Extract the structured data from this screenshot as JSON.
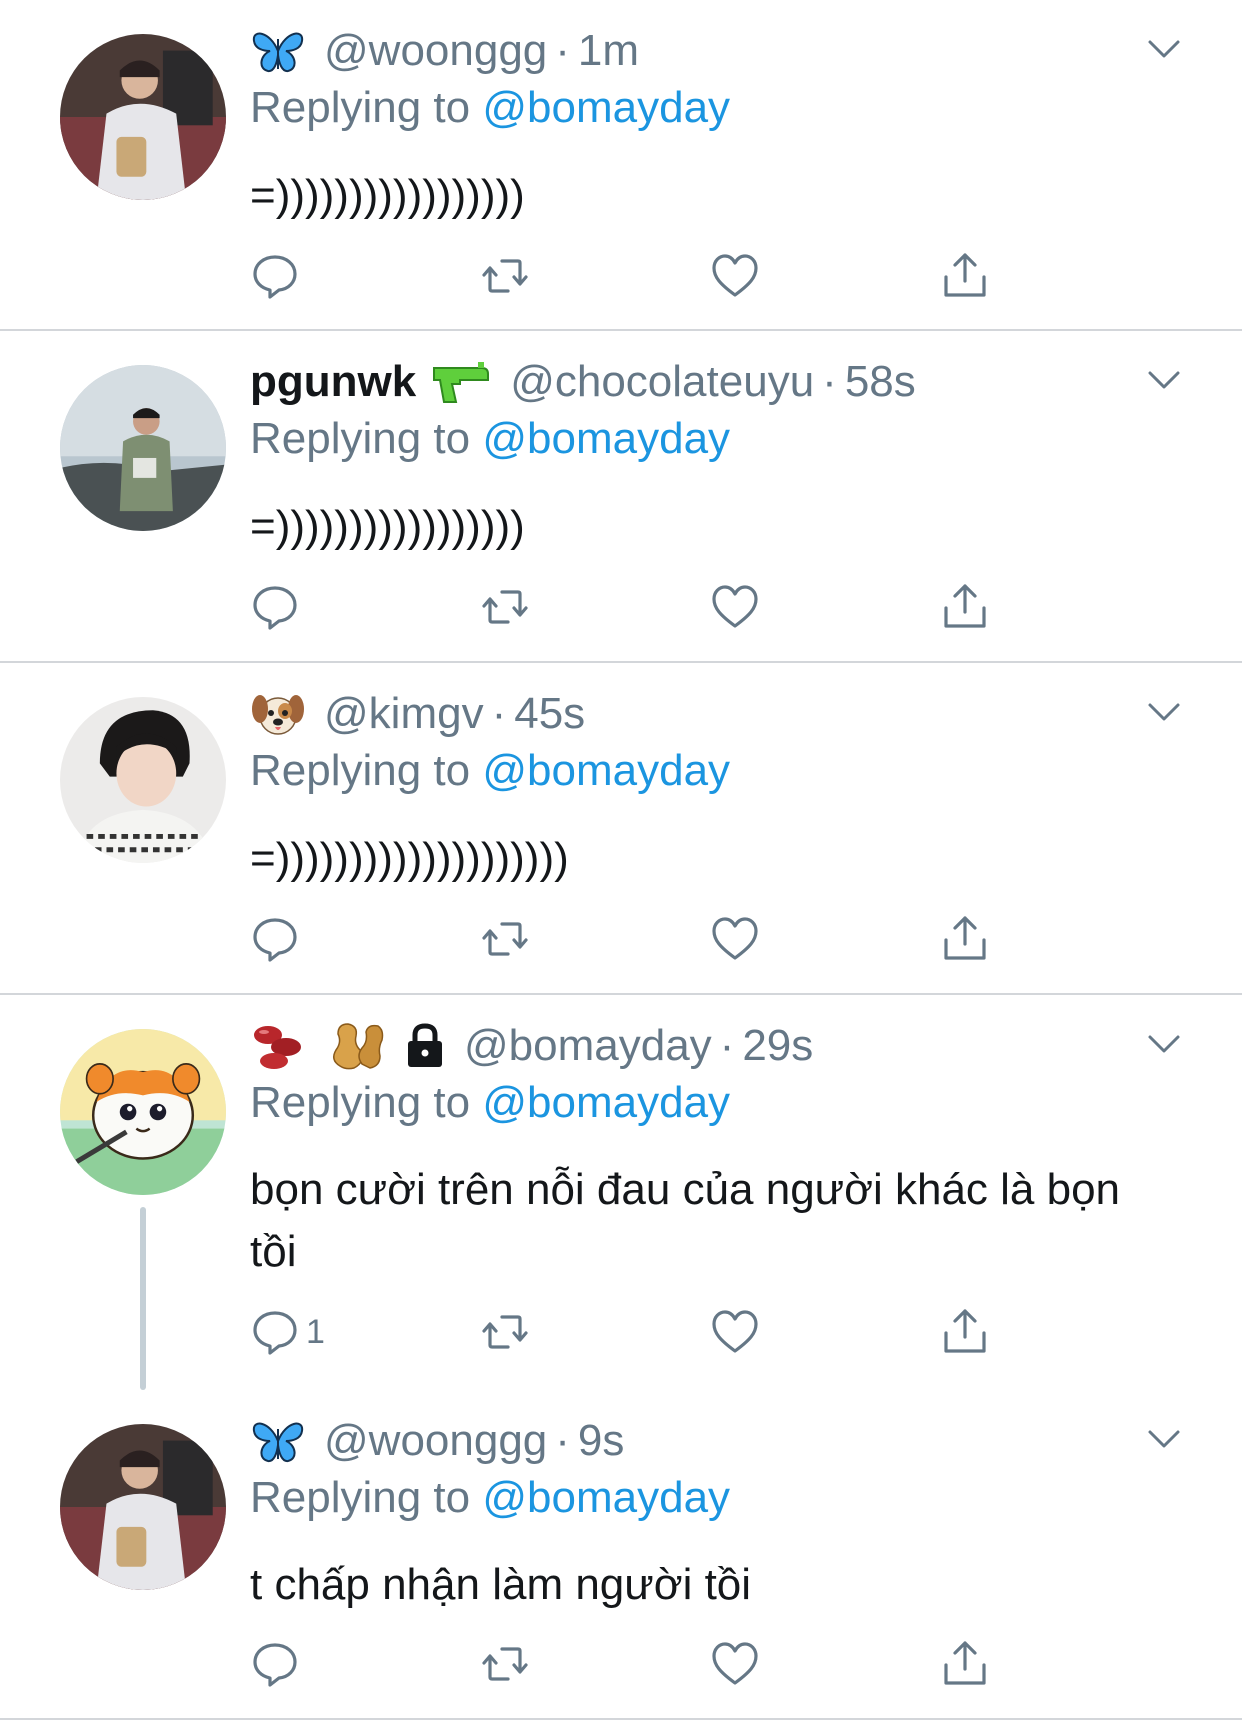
{
  "tweets": [
    {
      "display_name": "",
      "emojis": [
        "butterfly-emoji"
      ],
      "handle": "@woonggg",
      "separator": "·",
      "time": "1m",
      "reply_prefix": "Replying to",
      "reply_to": "@bomayday",
      "text": "=)))))))))))))))))",
      "reply_count": "",
      "avatar": "photo-person-hoodie"
    },
    {
      "display_name": "pgunwk",
      "emojis": [
        "water-pistol-emoji"
      ],
      "handle": "@chocolateuyu",
      "separator": "·",
      "time": "58s",
      "reply_prefix": "Replying to",
      "reply_to": "@bomayday",
      "text": "=)))))))))))))))))",
      "reply_count": "",
      "avatar": "photo-person-seaside"
    },
    {
      "display_name": "",
      "emojis": [
        "dog-face-emoji"
      ],
      "handle": "@kimgv",
      "separator": "·",
      "time": "45s",
      "reply_prefix": "Replying to",
      "reply_to": "@bomayday",
      "text": "=))))))))))))))))))))",
      "reply_count": "",
      "avatar": "photo-person-sweater"
    },
    {
      "display_name": "",
      "emojis": [
        "beans-emoji",
        "peanuts-emoji",
        "lock-icon"
      ],
      "handle": "@bomayday",
      "separator": "·",
      "time": "29s",
      "reply_prefix": "Replying to",
      "reply_to": "@bomayday",
      "text": "bọn cười trên nỗi đau của người khác là bọn tồi",
      "reply_count": "1",
      "avatar": "cartoon-hamster"
    },
    {
      "display_name": "",
      "emojis": [
        "butterfly-emoji"
      ],
      "handle": "@woonggg",
      "separator": "·",
      "time": "9s",
      "reply_prefix": "Replying to",
      "reply_to": "@bomayday",
      "text": "t chấp nhận làm người tồi",
      "reply_count": "",
      "avatar": "photo-person-hoodie"
    }
  ],
  "colors": {
    "link": "#1b95e0",
    "secondary": "#657786",
    "divider": "#d3d6da",
    "icon": "#657786"
  }
}
